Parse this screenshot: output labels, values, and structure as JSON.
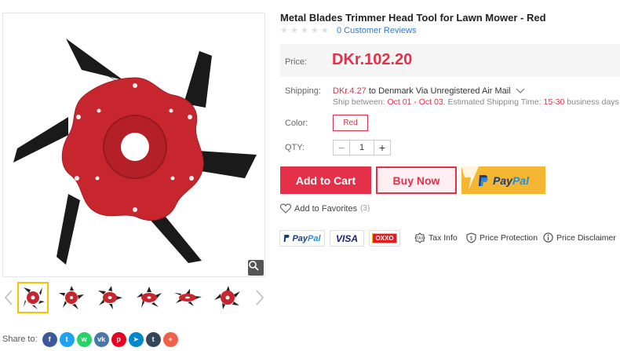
{
  "product": {
    "title": "Metal Blades Trimmer Head Tool for Lawn Mower - Red",
    "reviews_link": "0 Customer Reviews",
    "stars": 5
  },
  "price": {
    "label": "Price:",
    "value": "DKr.102.20"
  },
  "shipping": {
    "label": "Shipping:",
    "cost": "DKr.4.27",
    "destination": " to Denmark Via Unregistered Air Mail",
    "between_label": "Ship between: ",
    "dates": "Oct 01 - Oct 03",
    "estimated_label": ". Estimated Shipping Time: ",
    "days_range": "15-30",
    "days_suffix": " business days"
  },
  "color": {
    "label": "Color:",
    "selected": "Red"
  },
  "qty": {
    "label": "QTY:",
    "value": "1",
    "minus": "−",
    "plus": "+"
  },
  "actions": {
    "add_to_cart": "Add to Cart",
    "buy_now": "Buy Now",
    "paypal_pay": "Pay",
    "paypal_pal": "Pal"
  },
  "favorites": {
    "label": "Add to Favorites",
    "count": "(3)"
  },
  "payment_methods": {
    "paypal_pay": "Pay",
    "paypal_pal": "Pal",
    "visa": "VISA",
    "oxxo": "OXXO"
  },
  "features": {
    "tax": "Tax Info",
    "protection": "Price Protection",
    "disclaimer": "Price Disclaimer"
  },
  "share": {
    "label": "Share to:",
    "networks": [
      {
        "name": "facebook",
        "glyph": "f",
        "color": "#3b5998"
      },
      {
        "name": "twitter",
        "glyph": "t",
        "color": "#1da1f2"
      },
      {
        "name": "whatsapp",
        "glyph": "w",
        "color": "#25d366"
      },
      {
        "name": "vk",
        "glyph": "vk",
        "color": "#4a76a8"
      },
      {
        "name": "pinterest",
        "glyph": "p",
        "color": "#e60023"
      },
      {
        "name": "telegram",
        "glyph": "➤",
        "color": "#0088cc"
      },
      {
        "name": "tumblr",
        "glyph": "t",
        "color": "#35465c"
      },
      {
        "name": "more",
        "glyph": "+",
        "color": "#f06048"
      }
    ]
  },
  "colors": {
    "accent": "#e5304a",
    "link": "#2b7bd6",
    "paypal_yellow": "#f5b731",
    "product_red": "#c8262e"
  }
}
